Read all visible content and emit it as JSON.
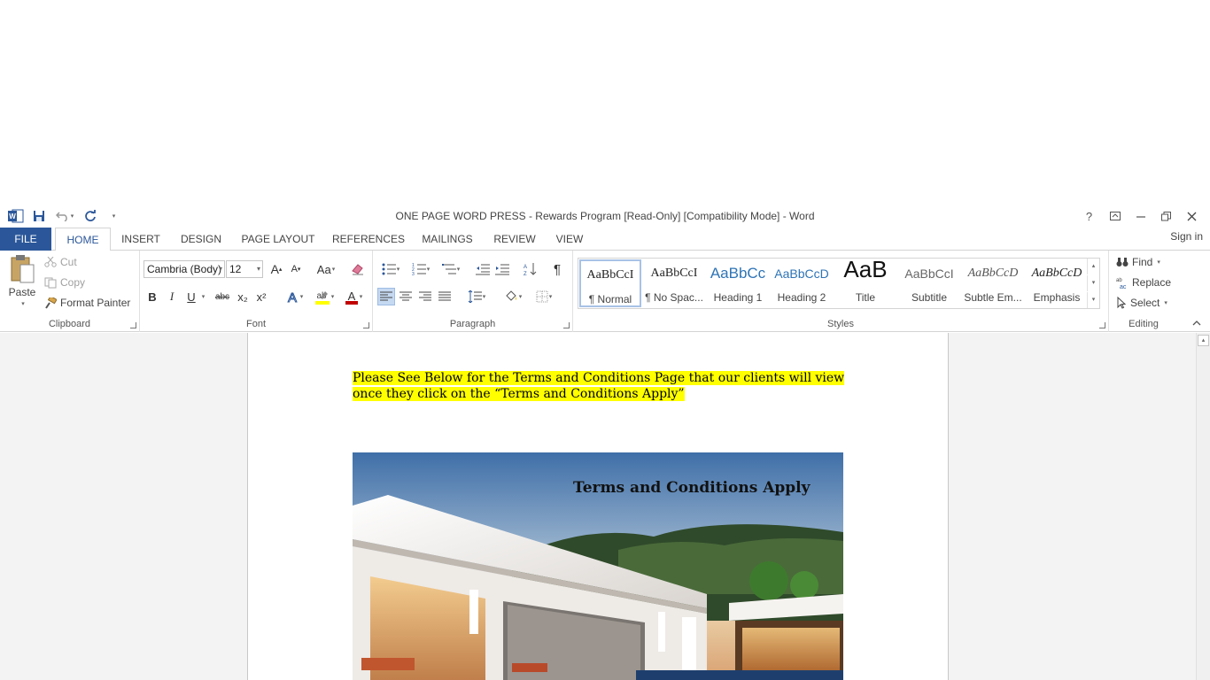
{
  "window": {
    "title": "ONE PAGE WORD PRESS - Rewards Program  [Read-Only] [Compatibility Mode] - Word",
    "help": "?",
    "controls": [
      "ribbon-display-options",
      "minimize",
      "restore",
      "close"
    ]
  },
  "tabs": {
    "file": "FILE",
    "home": "HOME",
    "insert": "INSERT",
    "design": "DESIGN",
    "page_layout": "PAGE LAYOUT",
    "references": "REFERENCES",
    "mailings": "MAILINGS",
    "review": "REVIEW",
    "view": "VIEW",
    "active": "HOME"
  },
  "signin": "Sign in",
  "clipboard": {
    "label": "Clipboard",
    "paste": "Paste",
    "cut": "Cut",
    "copy": "Copy",
    "format_painter": "Format Painter"
  },
  "font": {
    "label": "Font",
    "family": "Cambria (Body)",
    "size": "12",
    "bold": "B",
    "italic": "I",
    "underline": "U",
    "strikethrough": "abc",
    "subscript": "x₂",
    "superscript": "x²",
    "change_case": "Aa",
    "grow": "A",
    "shrink": "A"
  },
  "paragraph": {
    "label": "Paragraph",
    "pilcrow": "¶"
  },
  "styles": {
    "label": "Styles",
    "items": [
      {
        "preview": "AaBbCcI",
        "name": "¶ Normal"
      },
      {
        "preview": "AaBbCcI",
        "name": "¶ No Spac..."
      },
      {
        "preview": "AaBbCc",
        "name": "Heading 1"
      },
      {
        "preview": "AaBbCcD",
        "name": "Heading 2"
      },
      {
        "preview": "AaB",
        "name": "Title"
      },
      {
        "preview": "AaBbCcI",
        "name": "Subtitle"
      },
      {
        "preview": "AaBbCcD",
        "name": "Subtle Em..."
      },
      {
        "preview": "AaBbCcD",
        "name": "Emphasis"
      }
    ],
    "selected": "¶ Normal"
  },
  "editing": {
    "label": "Editing",
    "find": "Find",
    "replace": "Replace",
    "select": "Select"
  },
  "document": {
    "line1": "Please See Below for the Terms and Conditions Page that our clients will view",
    "line2": "once they click on the “Terms and Conditions Apply”",
    "image_heading": "Terms and Conditions Apply"
  },
  "colors": {
    "accent": "#2b579a",
    "highlight": "#ffff00",
    "font_color": "#c00000"
  }
}
